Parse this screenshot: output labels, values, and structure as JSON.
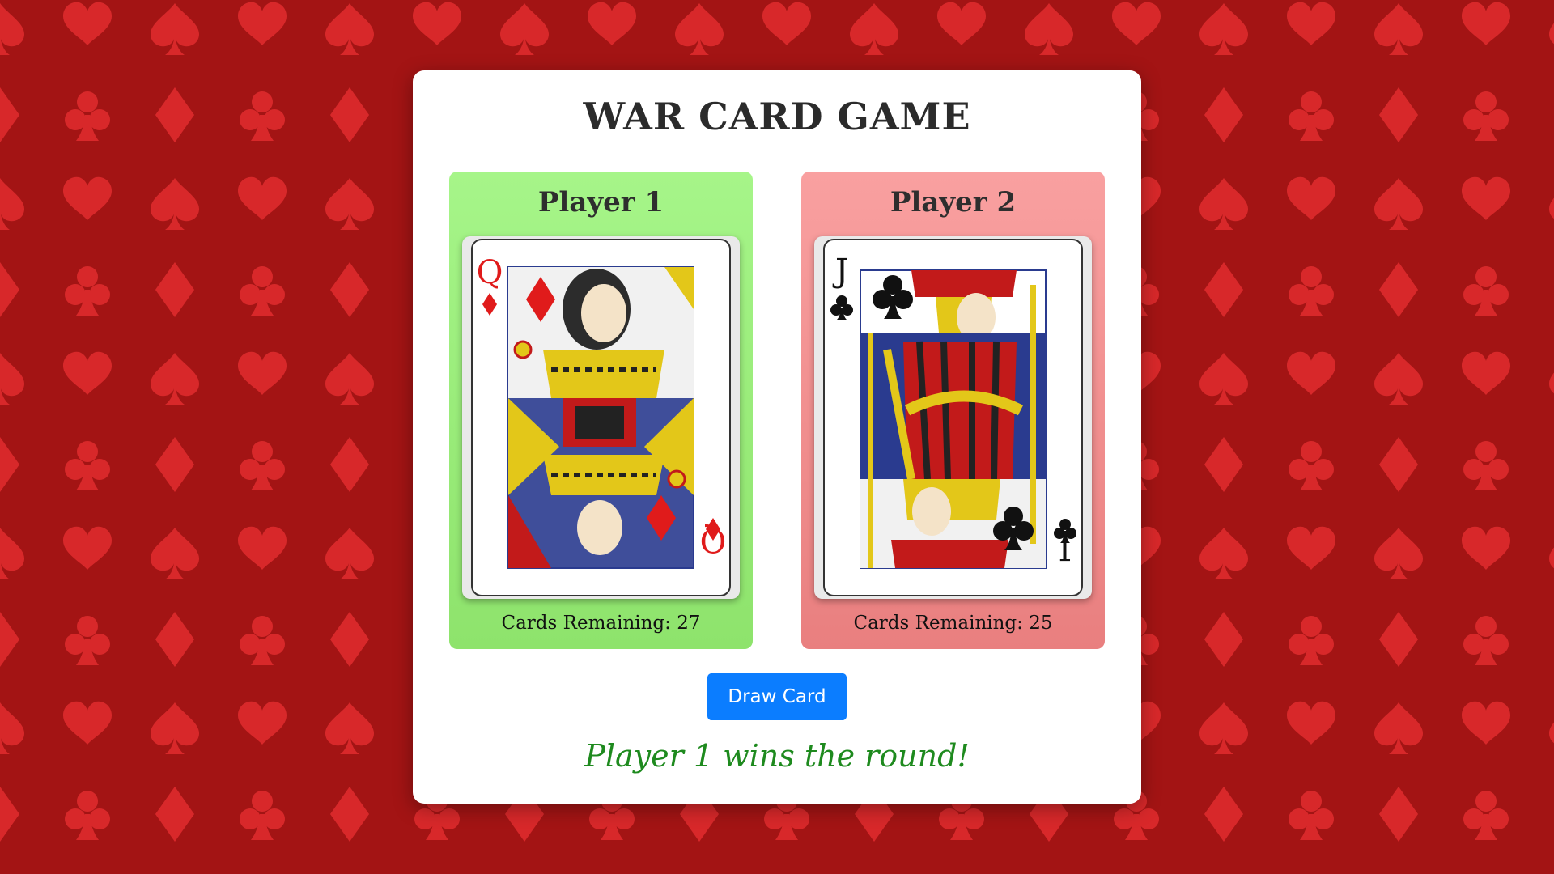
{
  "game": {
    "title": "WAR CARD GAME",
    "draw_button_label": "Draw Card",
    "result_text": "Player 1 wins the round!",
    "result_color": "#1e8a1e"
  },
  "players": [
    {
      "name": "Player 1",
      "card": {
        "rank": "Q",
        "suit": "diamonds",
        "suit_icon": "diamond-icon",
        "color": "#e01b1b"
      },
      "remaining_label": "Cards Remaining: 27",
      "panel_color": "#9deb7c",
      "status": "winner"
    },
    {
      "name": "Player 2",
      "card": {
        "rank": "J",
        "suit": "clubs",
        "suit_icon": "club-icon",
        "color": "#111111"
      },
      "remaining_label": "Cards Remaining: 25",
      "panel_color": "#f19090",
      "status": "loser"
    }
  ],
  "colors": {
    "background": "#a31414",
    "background_pattern": "#d8282a",
    "button": "#0b7dff"
  }
}
